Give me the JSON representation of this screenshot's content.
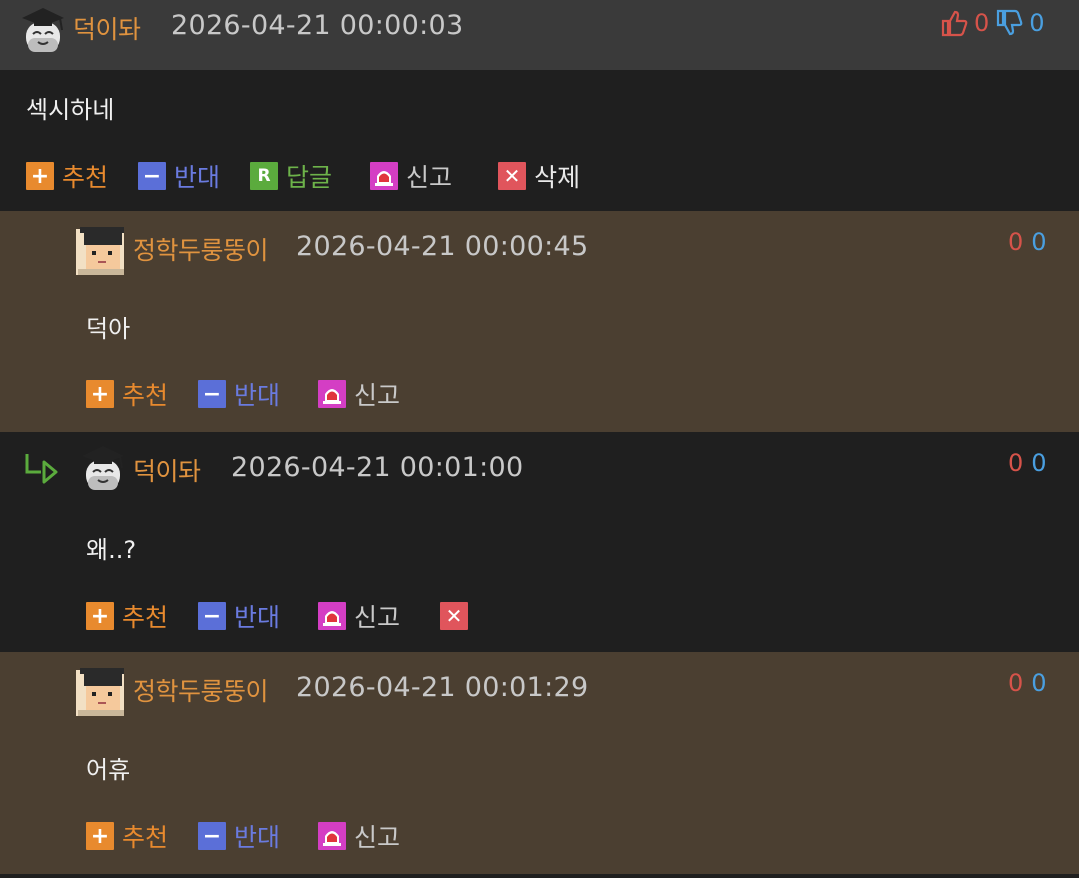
{
  "post": {
    "author": "덕이돠",
    "datetime": "2026-04-21 00:00:03",
    "upvotes": "0",
    "downvotes": "0",
    "content": "섹시하네",
    "actions": {
      "recommend": "추천",
      "oppose": "반대",
      "reply": "답글",
      "report": "신고",
      "delete": "삭제"
    },
    "reply_icon_letter": "R"
  },
  "replies": [
    {
      "author": "정학두룽뚱이",
      "datetime": "2026-04-21 00:00:45",
      "upvotes": "0",
      "downvotes": "0",
      "content": "덕아",
      "actions": {
        "recommend": "추천",
        "oppose": "반대",
        "report": "신고"
      }
    },
    {
      "author": "덕이돠",
      "datetime": "2026-04-21 00:01:00",
      "upvotes": "0",
      "downvotes": "0",
      "content": "왜..?",
      "actions": {
        "recommend": "추천",
        "oppose": "반대",
        "report": "신고"
      }
    },
    {
      "author": "정학두룽뚱이",
      "datetime": "2026-04-21 00:01:29",
      "upvotes": "0",
      "downvotes": "0",
      "content": "어휴",
      "actions": {
        "recommend": "추천",
        "oppose": "반대",
        "report": "신고"
      }
    }
  ],
  "colors": {
    "author": "#e0933f",
    "upvote": "#d6534a",
    "downvote": "#4a9fe0",
    "recommend": "#e88a2e",
    "oppose": "#5b6fd8",
    "reply": "#5bab3d",
    "report": "#d43ec4",
    "delete": "#e0555c",
    "brown_bg": "#4b3f31",
    "dark_bg": "#1f1f1f"
  },
  "icons": [
    "ghost-avatar",
    "student-avatar",
    "thumbs-up-icon",
    "thumbs-down-icon",
    "plus-icon",
    "minus-icon",
    "reply-icon",
    "siren-icon",
    "close-icon",
    "reply-arrow-icon"
  ]
}
